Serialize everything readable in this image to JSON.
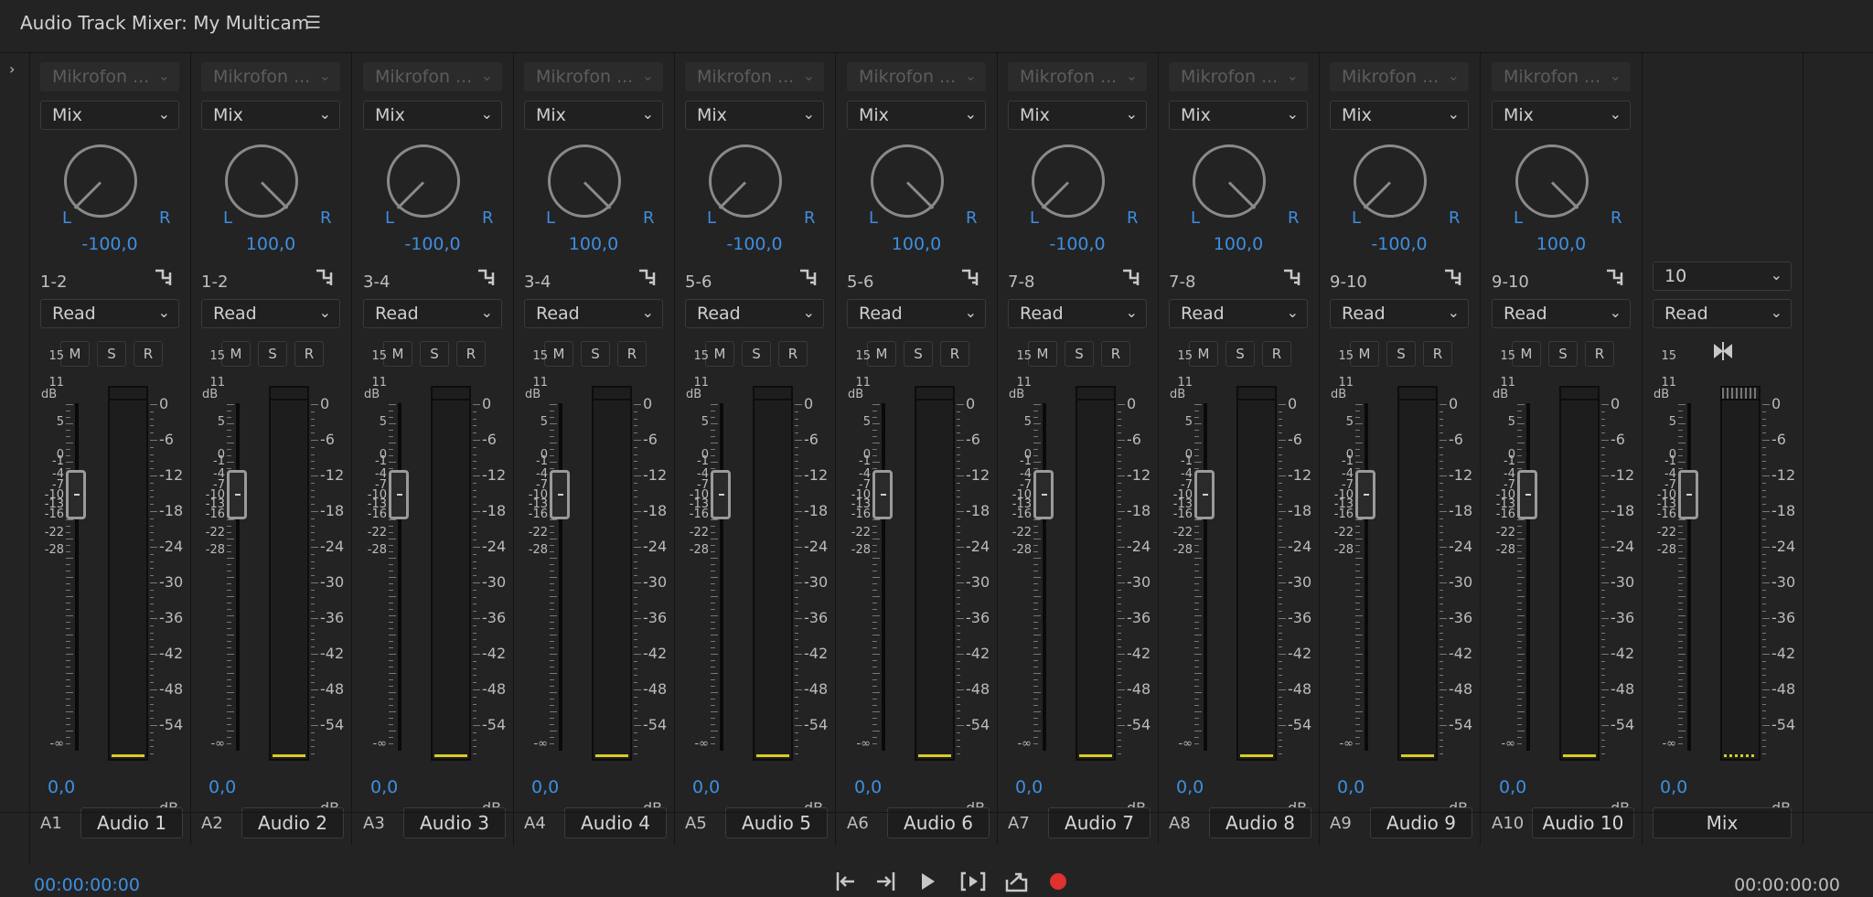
{
  "window": {
    "title": "Audio Track Mixer: My Multicam"
  },
  "colors": {
    "accent_blue": "#3e8ee0",
    "meter_yellow": "#d8cc24",
    "record_red": "#e03030",
    "background": "#232323"
  },
  "tracks": [
    {
      "id": "A1",
      "input": "Mikrofon ...",
      "effect": "Mix",
      "pan": "-100,0",
      "channels": "1-2",
      "automation": "Read",
      "volume": "0,0",
      "name": "Audio 1",
      "pan_direction": "left"
    },
    {
      "id": "A2",
      "input": "Mikrofon ...",
      "effect": "Mix",
      "pan": "100,0",
      "channels": "1-2",
      "automation": "Read",
      "volume": "0,0",
      "name": "Audio 2",
      "pan_direction": "right"
    },
    {
      "id": "A3",
      "input": "Mikrofon ...",
      "effect": "Mix",
      "pan": "-100,0",
      "channels": "3-4",
      "automation": "Read",
      "volume": "0,0",
      "name": "Audio 3",
      "pan_direction": "left"
    },
    {
      "id": "A4",
      "input": "Mikrofon ...",
      "effect": "Mix",
      "pan": "100,0",
      "channels": "3-4",
      "automation": "Read",
      "volume": "0,0",
      "name": "Audio 4",
      "pan_direction": "right"
    },
    {
      "id": "A5",
      "input": "Mikrofon ...",
      "effect": "Mix",
      "pan": "-100,0",
      "channels": "5-6",
      "automation": "Read",
      "volume": "0,0",
      "name": "Audio 5",
      "pan_direction": "left"
    },
    {
      "id": "A6",
      "input": "Mikrofon ...",
      "effect": "Mix",
      "pan": "100,0",
      "channels": "5-6",
      "automation": "Read",
      "volume": "0,0",
      "name": "Audio 6",
      "pan_direction": "right"
    },
    {
      "id": "A7",
      "input": "Mikrofon ...",
      "effect": "Mix",
      "pan": "-100,0",
      "channels": "7-8",
      "automation": "Read",
      "volume": "0,0",
      "name": "Audio 7",
      "pan_direction": "left"
    },
    {
      "id": "A8",
      "input": "Mikrofon ...",
      "effect": "Mix",
      "pan": "100,0",
      "channels": "7-8",
      "automation": "Read",
      "volume": "0,0",
      "name": "Audio 8",
      "pan_direction": "right"
    },
    {
      "id": "A9",
      "input": "Mikrofon ...",
      "effect": "Mix",
      "pan": "-100,0",
      "channels": "9-10",
      "automation": "Read",
      "volume": "0,0",
      "name": "Audio 9",
      "pan_direction": "left"
    },
    {
      "id": "A10",
      "input": "Mikrofon ...",
      "effect": "Mix",
      "pan": "100,0",
      "channels": "9-10",
      "automation": "Read",
      "volume": "0,0",
      "name": "Audio 10",
      "pan_direction": "right"
    }
  ],
  "master": {
    "channels": "10",
    "automation": "Read",
    "volume": "0,0",
    "name": "Mix"
  },
  "buttons": {
    "mute": "M",
    "solo": "S",
    "record": "R"
  },
  "pan_labels": {
    "left": "L",
    "right": "R"
  },
  "fader_scale": {
    "unit": "dB",
    "labels": [
      "15",
      "11",
      "5",
      "0",
      "-1",
      "-4",
      "-7",
      "-10",
      "-13",
      "-16",
      "-22",
      "-28",
      "-∞"
    ],
    "values": [
      15,
      11,
      5,
      0,
      -1,
      -4,
      -7,
      -10,
      -13,
      -16,
      -22,
      -28,
      -60
    ]
  },
  "meter_scale": {
    "unit": "dB",
    "labels": [
      "0",
      "-6",
      "-12",
      "-18",
      "-24",
      "-30",
      "-36",
      "-42",
      "-48",
      "-54"
    ]
  },
  "transport": {
    "current_timecode": "00:00:00:00",
    "duration_timecode": "00:00:00:00",
    "icons": [
      "go-to-in-icon",
      "go-to-out-icon",
      "play-icon",
      "play-in-to-out-icon",
      "loop-icon",
      "record-icon"
    ]
  },
  "icons": {
    "panel_menu": "hamburger-menu-icon",
    "expand": "chevron-right-icon",
    "routing": "routing-icon",
    "link_channels": "bowtie-link-icon"
  }
}
